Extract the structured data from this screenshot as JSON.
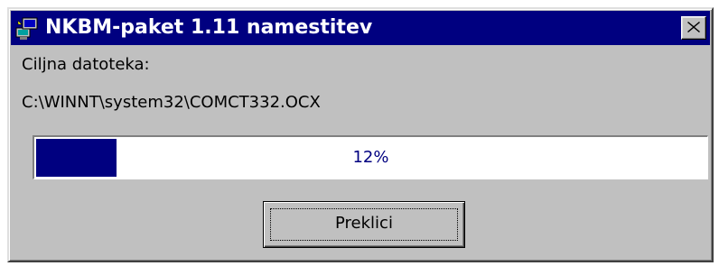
{
  "window": {
    "title": "NKBM-paket 1.11 namestitev",
    "app_icon": "installer-computer-icon",
    "close_icon": "close-icon"
  },
  "content": {
    "target_label": "Ciljna datoteka:",
    "target_path": "C:\\WINNT\\system32\\COMCT332.OCX"
  },
  "progress": {
    "percent": 12,
    "text": "12%",
    "fill_color": "#000080"
  },
  "buttons": {
    "cancel_label": "Preklici"
  },
  "colors": {
    "titlebar": "#000080",
    "face": "#c0c0c0"
  }
}
